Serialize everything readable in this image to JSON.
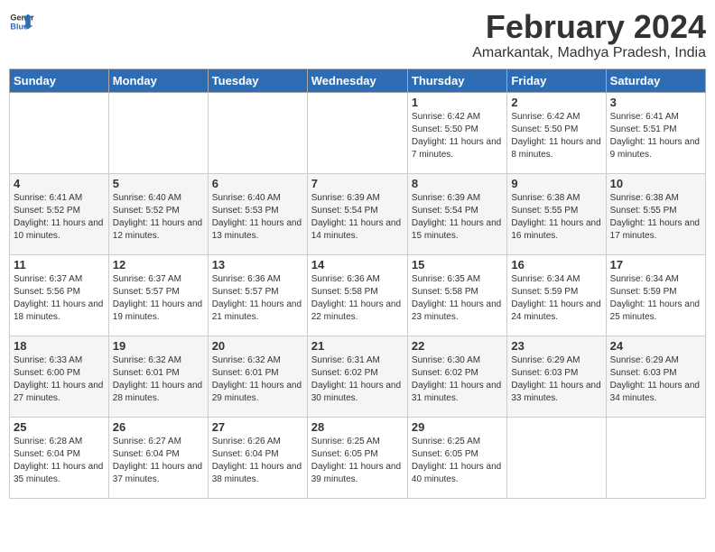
{
  "header": {
    "logo_general": "General",
    "logo_blue": "Blue",
    "month_year": "February 2024",
    "location": "Amarkantak, Madhya Pradesh, India"
  },
  "days_of_week": [
    "Sunday",
    "Monday",
    "Tuesday",
    "Wednesday",
    "Thursday",
    "Friday",
    "Saturday"
  ],
  "weeks": [
    [
      {
        "day": "",
        "sunrise": "",
        "sunset": "",
        "daylight": ""
      },
      {
        "day": "",
        "sunrise": "",
        "sunset": "",
        "daylight": ""
      },
      {
        "day": "",
        "sunrise": "",
        "sunset": "",
        "daylight": ""
      },
      {
        "day": "",
        "sunrise": "",
        "sunset": "",
        "daylight": ""
      },
      {
        "day": "1",
        "sunrise": "Sunrise: 6:42 AM",
        "sunset": "Sunset: 5:50 PM",
        "daylight": "Daylight: 11 hours and 7 minutes."
      },
      {
        "day": "2",
        "sunrise": "Sunrise: 6:42 AM",
        "sunset": "Sunset: 5:50 PM",
        "daylight": "Daylight: 11 hours and 8 minutes."
      },
      {
        "day": "3",
        "sunrise": "Sunrise: 6:41 AM",
        "sunset": "Sunset: 5:51 PM",
        "daylight": "Daylight: 11 hours and 9 minutes."
      }
    ],
    [
      {
        "day": "4",
        "sunrise": "Sunrise: 6:41 AM",
        "sunset": "Sunset: 5:52 PM",
        "daylight": "Daylight: 11 hours and 10 minutes."
      },
      {
        "day": "5",
        "sunrise": "Sunrise: 6:40 AM",
        "sunset": "Sunset: 5:52 PM",
        "daylight": "Daylight: 11 hours and 12 minutes."
      },
      {
        "day": "6",
        "sunrise": "Sunrise: 6:40 AM",
        "sunset": "Sunset: 5:53 PM",
        "daylight": "Daylight: 11 hours and 13 minutes."
      },
      {
        "day": "7",
        "sunrise": "Sunrise: 6:39 AM",
        "sunset": "Sunset: 5:54 PM",
        "daylight": "Daylight: 11 hours and 14 minutes."
      },
      {
        "day": "8",
        "sunrise": "Sunrise: 6:39 AM",
        "sunset": "Sunset: 5:54 PM",
        "daylight": "Daylight: 11 hours and 15 minutes."
      },
      {
        "day": "9",
        "sunrise": "Sunrise: 6:38 AM",
        "sunset": "Sunset: 5:55 PM",
        "daylight": "Daylight: 11 hours and 16 minutes."
      },
      {
        "day": "10",
        "sunrise": "Sunrise: 6:38 AM",
        "sunset": "Sunset: 5:55 PM",
        "daylight": "Daylight: 11 hours and 17 minutes."
      }
    ],
    [
      {
        "day": "11",
        "sunrise": "Sunrise: 6:37 AM",
        "sunset": "Sunset: 5:56 PM",
        "daylight": "Daylight: 11 hours and 18 minutes."
      },
      {
        "day": "12",
        "sunrise": "Sunrise: 6:37 AM",
        "sunset": "Sunset: 5:57 PM",
        "daylight": "Daylight: 11 hours and 19 minutes."
      },
      {
        "day": "13",
        "sunrise": "Sunrise: 6:36 AM",
        "sunset": "Sunset: 5:57 PM",
        "daylight": "Daylight: 11 hours and 21 minutes."
      },
      {
        "day": "14",
        "sunrise": "Sunrise: 6:36 AM",
        "sunset": "Sunset: 5:58 PM",
        "daylight": "Daylight: 11 hours and 22 minutes."
      },
      {
        "day": "15",
        "sunrise": "Sunrise: 6:35 AM",
        "sunset": "Sunset: 5:58 PM",
        "daylight": "Daylight: 11 hours and 23 minutes."
      },
      {
        "day": "16",
        "sunrise": "Sunrise: 6:34 AM",
        "sunset": "Sunset: 5:59 PM",
        "daylight": "Daylight: 11 hours and 24 minutes."
      },
      {
        "day": "17",
        "sunrise": "Sunrise: 6:34 AM",
        "sunset": "Sunset: 5:59 PM",
        "daylight": "Daylight: 11 hours and 25 minutes."
      }
    ],
    [
      {
        "day": "18",
        "sunrise": "Sunrise: 6:33 AM",
        "sunset": "Sunset: 6:00 PM",
        "daylight": "Daylight: 11 hours and 27 minutes."
      },
      {
        "day": "19",
        "sunrise": "Sunrise: 6:32 AM",
        "sunset": "Sunset: 6:01 PM",
        "daylight": "Daylight: 11 hours and 28 minutes."
      },
      {
        "day": "20",
        "sunrise": "Sunrise: 6:32 AM",
        "sunset": "Sunset: 6:01 PM",
        "daylight": "Daylight: 11 hours and 29 minutes."
      },
      {
        "day": "21",
        "sunrise": "Sunrise: 6:31 AM",
        "sunset": "Sunset: 6:02 PM",
        "daylight": "Daylight: 11 hours and 30 minutes."
      },
      {
        "day": "22",
        "sunrise": "Sunrise: 6:30 AM",
        "sunset": "Sunset: 6:02 PM",
        "daylight": "Daylight: 11 hours and 31 minutes."
      },
      {
        "day": "23",
        "sunrise": "Sunrise: 6:29 AM",
        "sunset": "Sunset: 6:03 PM",
        "daylight": "Daylight: 11 hours and 33 minutes."
      },
      {
        "day": "24",
        "sunrise": "Sunrise: 6:29 AM",
        "sunset": "Sunset: 6:03 PM",
        "daylight": "Daylight: 11 hours and 34 minutes."
      }
    ],
    [
      {
        "day": "25",
        "sunrise": "Sunrise: 6:28 AM",
        "sunset": "Sunset: 6:04 PM",
        "daylight": "Daylight: 11 hours and 35 minutes."
      },
      {
        "day": "26",
        "sunrise": "Sunrise: 6:27 AM",
        "sunset": "Sunset: 6:04 PM",
        "daylight": "Daylight: 11 hours and 37 minutes."
      },
      {
        "day": "27",
        "sunrise": "Sunrise: 6:26 AM",
        "sunset": "Sunset: 6:04 PM",
        "daylight": "Daylight: 11 hours and 38 minutes."
      },
      {
        "day": "28",
        "sunrise": "Sunrise: 6:25 AM",
        "sunset": "Sunset: 6:05 PM",
        "daylight": "Daylight: 11 hours and 39 minutes."
      },
      {
        "day": "29",
        "sunrise": "Sunrise: 6:25 AM",
        "sunset": "Sunset: 6:05 PM",
        "daylight": "Daylight: 11 hours and 40 minutes."
      },
      {
        "day": "",
        "sunrise": "",
        "sunset": "",
        "daylight": ""
      },
      {
        "day": "",
        "sunrise": "",
        "sunset": "",
        "daylight": ""
      }
    ]
  ]
}
